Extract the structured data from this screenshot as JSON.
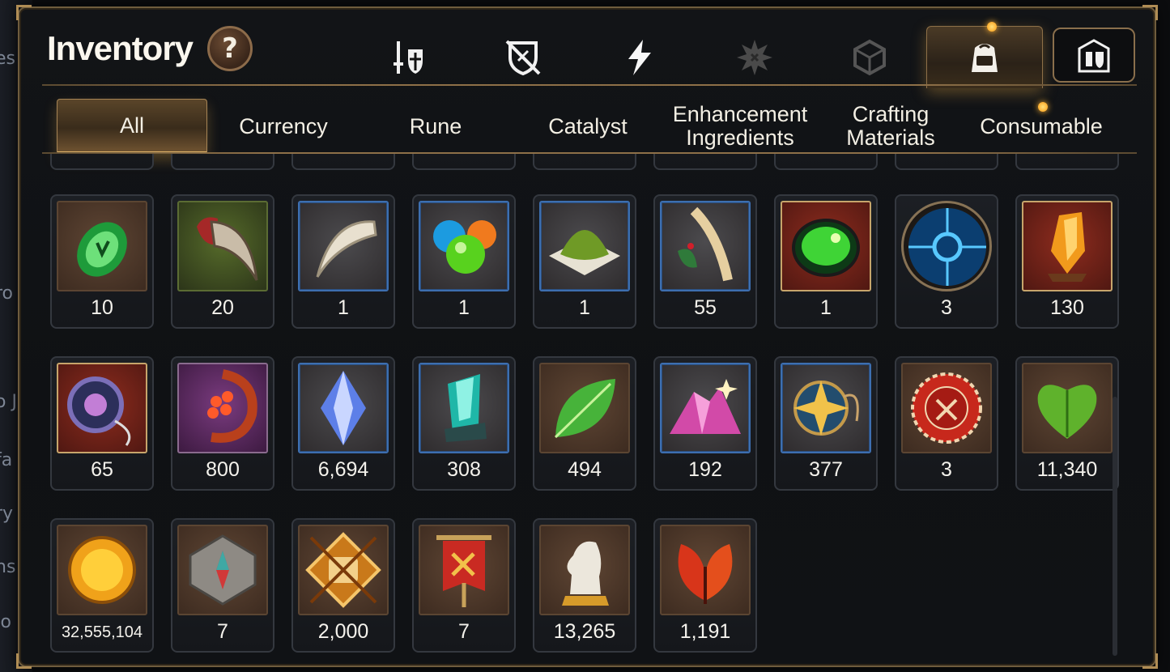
{
  "header": {
    "title": "Inventory",
    "help_label": "?"
  },
  "category_tabs": [
    {
      "icon": "sword-shield-icon",
      "active": false
    },
    {
      "icon": "broken-shield-icon",
      "active": false
    },
    {
      "icon": "lightning-icon",
      "active": false
    },
    {
      "icon": "splatter-emblem-icon",
      "active": false
    },
    {
      "icon": "cube-icon",
      "active": false
    },
    {
      "icon": "backpack-icon",
      "active": true,
      "notification": true
    },
    {
      "icon": "guild-castle-icon",
      "active": false
    }
  ],
  "sub_tabs": [
    {
      "label": "All",
      "active": true
    },
    {
      "label": "Currency",
      "active": false
    },
    {
      "label": "Rune",
      "active": false
    },
    {
      "label": "Catalyst",
      "active": false
    },
    {
      "label": "Enhancement Ingredients",
      "active": false
    },
    {
      "label": "Crafting Materials",
      "active": false
    },
    {
      "label": "Consumable",
      "active": false,
      "notification": true
    }
  ],
  "items": {
    "row1": [
      {
        "qty": "10",
        "icon": "green-rune-stone-icon"
      },
      {
        "qty": "20",
        "icon": "beast-claw-icon"
      },
      {
        "qty": "1",
        "icon": "fang-icon"
      },
      {
        "qty": "1",
        "icon": "slime-orbs-icon"
      },
      {
        "qty": "1",
        "icon": "moss-pile-icon"
      },
      {
        "qty": "55",
        "icon": "herb-root-icon"
      },
      {
        "qty": "1",
        "icon": "green-potion-orb-icon"
      },
      {
        "qty": "3",
        "icon": "blue-rune-seal-icon"
      },
      {
        "qty": "130",
        "icon": "fire-crystal-icon"
      }
    ],
    "row2": [
      {
        "qty": "65",
        "icon": "pendant-necklace-icon"
      },
      {
        "qty": "800",
        "icon": "flower-charm-icon"
      },
      {
        "qty": "6,694",
        "icon": "blue-crystal-icon"
      },
      {
        "qty": "308",
        "icon": "teal-crystal-icon"
      },
      {
        "qty": "494",
        "icon": "green-leaf-icon"
      },
      {
        "qty": "192",
        "icon": "pink-ore-icon"
      },
      {
        "qty": "377",
        "icon": "star-medallion-icon"
      },
      {
        "qty": "3",
        "icon": "red-guild-seal-icon"
      },
      {
        "qty": "11,340",
        "icon": "green-heart-icon"
      }
    ],
    "row3": [
      {
        "qty": "32,555,104",
        "icon": "gold-coin-icon"
      },
      {
        "qty": "7",
        "icon": "stone-compass-icon"
      },
      {
        "qty": "2,000",
        "icon": "fist-emblem-icon"
      },
      {
        "qty": "7",
        "icon": "war-banner-icon"
      },
      {
        "qty": "13,265",
        "icon": "chess-knight-icon"
      },
      {
        "qty": "1,191",
        "icon": "red-leaves-icon"
      }
    ]
  },
  "colors": {
    "accent_gold": "#e2b56a",
    "panel_border": "#6f5c3d",
    "notify": "#ff9a10"
  }
}
